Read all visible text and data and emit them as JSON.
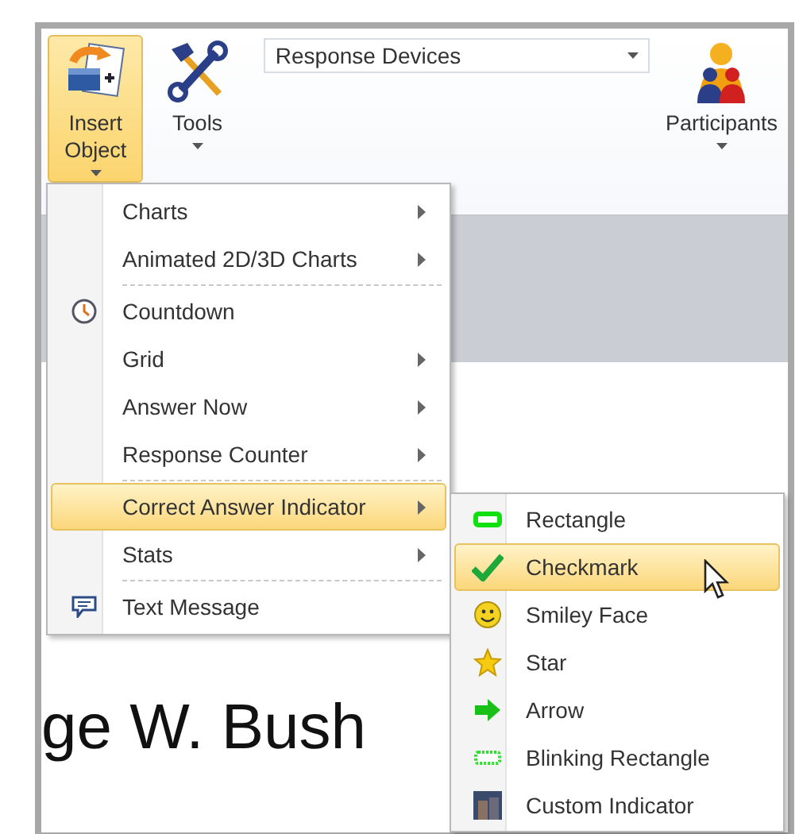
{
  "ribbon": {
    "buttons": [
      {
        "label": "Insert Object",
        "kind": "insert",
        "selected": true
      },
      {
        "label": "Tools",
        "kind": "tools",
        "selected": false
      }
    ],
    "device_field": {
      "value": "Response Devices"
    },
    "participants": {
      "label": "Participants"
    }
  },
  "slide": {
    "text": "ge W. Bush"
  },
  "menu": {
    "items": [
      {
        "label": "Charts",
        "kind": "submenu",
        "selected": false,
        "separator_after": false
      },
      {
        "label": "Animated 2D/3D Charts",
        "kind": "submenu",
        "selected": false,
        "separator_after": true
      },
      {
        "label": "Countdown",
        "kind": "countdown",
        "selected": false,
        "separator_after": false
      },
      {
        "label": "Grid",
        "kind": "submenu",
        "selected": false,
        "separator_after": false
      },
      {
        "label": "Answer Now",
        "kind": "submenu",
        "selected": false,
        "separator_after": false
      },
      {
        "label": "Response Counter",
        "kind": "submenu",
        "selected": false,
        "separator_after": true
      },
      {
        "label": "Correct Answer Indicator",
        "kind": "submenu",
        "selected": true,
        "separator_after": false
      },
      {
        "label": "Stats",
        "kind": "submenu",
        "selected": false,
        "separator_after": true
      },
      {
        "label": "Text Message",
        "kind": "message",
        "selected": false,
        "separator_after": false
      }
    ]
  },
  "submenu": {
    "items": [
      {
        "label": "Rectangle",
        "kind": "rectangle",
        "selected": false
      },
      {
        "label": "Checkmark",
        "kind": "checkmark",
        "selected": true
      },
      {
        "label": "Smiley Face",
        "kind": "smiley",
        "selected": false
      },
      {
        "label": "Star",
        "kind": "star",
        "selected": false
      },
      {
        "label": "Arrow",
        "kind": "arrow",
        "selected": false
      },
      {
        "label": "Blinking Rectangle",
        "kind": "blinking",
        "selected": false
      },
      {
        "label": "Custom Indicator",
        "kind": "custom",
        "selected": false
      }
    ]
  }
}
